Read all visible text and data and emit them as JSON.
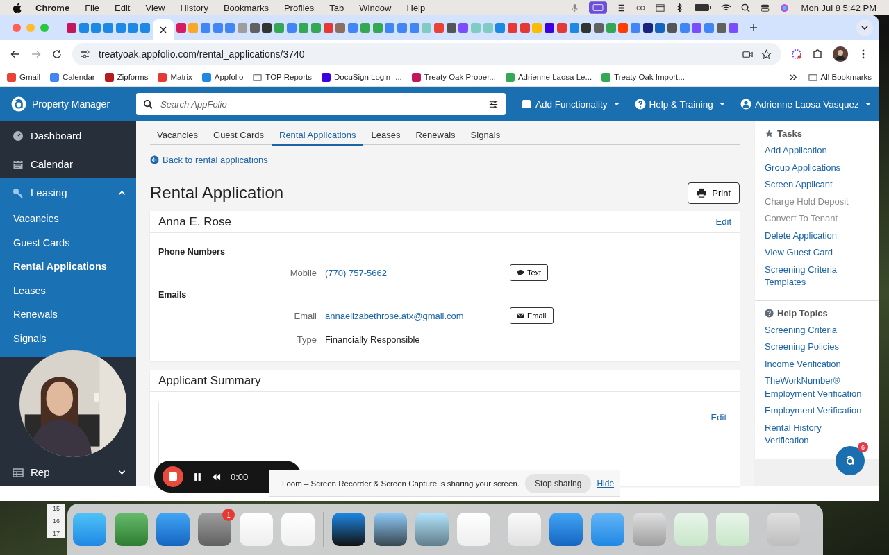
{
  "menubar": {
    "app": "Chrome",
    "menus": [
      "File",
      "Edit",
      "View",
      "History",
      "Bookmarks",
      "Profiles",
      "Tab",
      "Window",
      "Help"
    ],
    "clock": "Mon Jul 8 5:42 PM"
  },
  "browser": {
    "url": "treatyoak.appfolio.com/rental_applications/3740",
    "bookmarks": [
      "Gmail",
      "Calendar",
      "Zipforms",
      "Matrix",
      "Appfolio",
      "TOP Reports",
      "DocuSign Login -...",
      "Treaty Oak Proper...",
      "Adrienne Laosa Le...",
      "Treaty Oak Import..."
    ],
    "all_bookmarks": "All Bookmarks"
  },
  "header": {
    "brand": "Property Manager",
    "search_placeholder": "Search AppFolio",
    "menus": [
      "Add Functionality",
      "Help & Training",
      "Adrienne Laosa Vasquez"
    ]
  },
  "sidebar": {
    "items": [
      {
        "label": "Dashboard",
        "kind": "link"
      },
      {
        "label": "Calendar",
        "kind": "link"
      },
      {
        "label": "Leasing",
        "kind": "section",
        "expanded": true,
        "children": [
          {
            "label": "Vacancies",
            "selected": false
          },
          {
            "label": "Guest Cards",
            "selected": false
          },
          {
            "label": "Rental Applications",
            "selected": true
          },
          {
            "label": "Leases",
            "selected": false
          },
          {
            "label": "Renewals",
            "selected": false
          },
          {
            "label": "Signals",
            "selected": false
          }
        ]
      },
      {
        "label": "Rep",
        "kind": "section",
        "expanded": false
      }
    ]
  },
  "tabs": [
    {
      "label": "Vacancies",
      "selected": false
    },
    {
      "label": "Guest Cards",
      "selected": false
    },
    {
      "label": "Rental Applications",
      "selected": true
    },
    {
      "label": "Leases",
      "selected": false
    },
    {
      "label": "Renewals",
      "selected": false
    },
    {
      "label": "Signals",
      "selected": false
    }
  ],
  "back_link": "Back to rental applications",
  "title": "Rental Application",
  "print": "Print",
  "applicant": {
    "name": "Anna E. Rose",
    "edit": "Edit",
    "sections": [
      {
        "heading": "Phone Numbers",
        "rows": [
          {
            "label": "Mobile",
            "value": "(770) 757-5662",
            "kind": "phone",
            "action": "Text"
          }
        ]
      },
      {
        "heading": "Emails",
        "rows": [
          {
            "label": "Email",
            "value": "annaelizabethrose.atx@gmail.com",
            "kind": "email",
            "action": "Email"
          },
          {
            "label": "Type",
            "value": "Financially Responsible",
            "kind": "plain"
          }
        ]
      }
    ]
  },
  "summary": {
    "title": "Applicant Summary",
    "edit": "Edit"
  },
  "tasks": {
    "heading": "Tasks",
    "items": [
      {
        "label": "Add Application",
        "disabled": false
      },
      {
        "label": "Group Applications",
        "disabled": false
      },
      {
        "label": "Screen Applicant",
        "disabled": false
      },
      {
        "label": "Charge Hold Deposit",
        "disabled": true
      },
      {
        "label": "Convert To Tenant",
        "disabled": true
      },
      {
        "label": "Delete Application",
        "disabled": false
      },
      {
        "label": "View Guest Card",
        "disabled": false
      },
      {
        "label": "Screening Criteria Templates",
        "disabled": false
      }
    ]
  },
  "help_topics": {
    "heading": "Help Topics",
    "items": [
      "Screening Criteria",
      "Screening Policies",
      "Income Verification",
      "TheWorkNumber® Employment Verification",
      "Employment Verification",
      "Rental History Verification"
    ]
  },
  "chat_badge": "6",
  "loom": {
    "timer": "0:00",
    "banner": "Loom – Screen Recorder & Screen Capture is sharing your screen.",
    "stop": "Stop sharing",
    "hide": "Hide"
  },
  "dock": {
    "settings_badge": "1"
  },
  "desktop": {
    "calendar_days": [
      "15",
      "16",
      "17"
    ]
  }
}
